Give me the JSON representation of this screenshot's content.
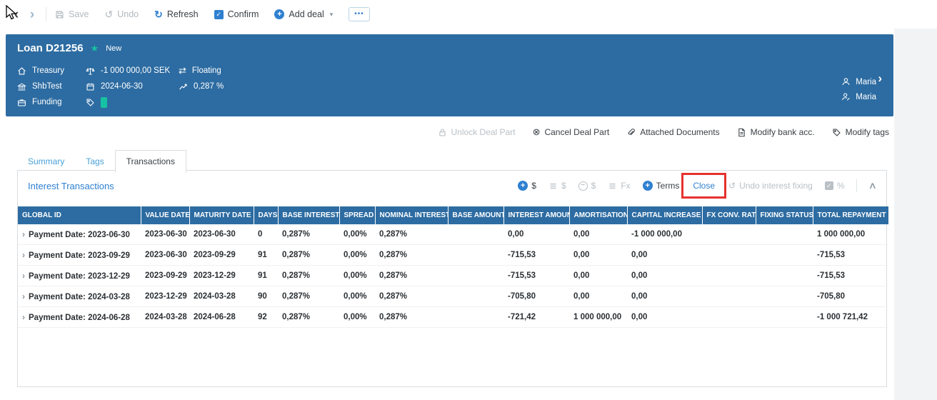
{
  "toolbar": {
    "back_icon": "‹",
    "forward_icon": "›",
    "save_label": "Save",
    "undo_label": "Undo",
    "refresh_label": "Refresh",
    "confirm_label": "Confirm",
    "add_deal_label": "Add deal",
    "more_label": "•••"
  },
  "deal_header": {
    "title": "Loan D21256",
    "status_badge": "New",
    "portfolio": "Treasury",
    "counterparty": "ShbTest",
    "purpose": "Funding",
    "nominal_amount": "-1 000 000,00 SEK",
    "maturity_date": "2024-06-30",
    "rate_type": "Floating",
    "interest_rate": "0,287 %",
    "owner": "Maria",
    "modified_by": "Maria",
    "expand_icon": "›"
  },
  "deal_actions": {
    "unlock": "Unlock Deal Part",
    "cancel": "Cancel Deal Part",
    "attached": "Attached Documents",
    "modify_bank": "Modify bank acc.",
    "modify_tags": "Modify tags"
  },
  "tabs": {
    "summary": "Summary",
    "tags": "Tags",
    "transactions": "Transactions"
  },
  "interest_section": {
    "title": "Interest Transactions",
    "tools": {
      "add_cashflow": "$",
      "schedule_cashflow": "$",
      "remove_cashflow": "$",
      "fx_schedule": "Fx",
      "terms": "Terms",
      "close": "Close",
      "undo_fixing": "Undo interest fixing",
      "percent": "%"
    }
  },
  "table": {
    "columns": [
      "GLOBAL ID",
      "VALUE DATE",
      "MATURITY DATE",
      "DAYS",
      "BASE INTEREST",
      "SPREAD",
      "NOMINAL INTEREST",
      "BASE AMOUNT",
      "INTEREST AMOUNT",
      "AMORTISATION",
      "CAPITAL INCREASE",
      "FX CONV. RATE",
      "FIXING STATUS",
      "TOTAL REPAYMENT"
    ],
    "rows": [
      [
        "Payment Date: 2023-06-30",
        "2023-06-30",
        "2023-06-30",
        "0",
        "0,287%",
        "0,00%",
        "0,287%",
        "",
        "0,00",
        "0,00",
        "-1 000 000,00",
        "",
        "",
        "1 000 000,00"
      ],
      [
        "Payment Date: 2023-09-29",
        "2023-06-30",
        "2023-09-29",
        "91",
        "0,287%",
        "0,00%",
        "0,287%",
        "",
        "-715,53",
        "0,00",
        "0,00",
        "",
        "",
        "-715,53"
      ],
      [
        "Payment Date: 2023-12-29",
        "2023-09-29",
        "2023-12-29",
        "91",
        "0,287%",
        "0,00%",
        "0,287%",
        "",
        "-715,53",
        "0,00",
        "0,00",
        "",
        "",
        "-715,53"
      ],
      [
        "Payment Date: 2024-03-28",
        "2023-12-29",
        "2024-03-28",
        "90",
        "0,287%",
        "0,00%",
        "0,287%",
        "",
        "-705,80",
        "0,00",
        "0,00",
        "",
        "",
        "-705,80"
      ],
      [
        "Payment Date: 2024-06-28",
        "2024-03-28",
        "2024-06-28",
        "92",
        "0,287%",
        "0,00%",
        "0,287%",
        "",
        "-721,42",
        "1 000 000,00",
        "0,00",
        "",
        "",
        "-1 000 721,42"
      ]
    ]
  },
  "glyphs": {
    "refresh": "↻",
    "undo": "↺",
    "caret_down": "▾",
    "star": "★",
    "swap": "⇄",
    "check": "✓",
    "cancel": "⊗",
    "collapse": "∧",
    "plus": "+",
    "minus": "−",
    "row_expand": "›"
  },
  "colors": {
    "header_blue": "#2d6ca2",
    "accent_blue": "#2f80d0",
    "highlight_red": "#e6322e",
    "badge_teal": "#16c2a3"
  }
}
